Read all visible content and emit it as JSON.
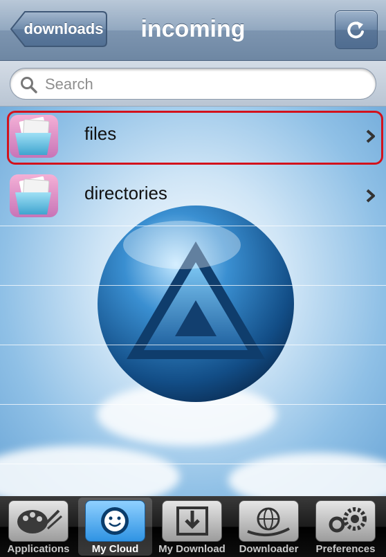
{
  "nav": {
    "back_label": "downloads",
    "title": "incoming",
    "refresh_icon": "refresh-icon"
  },
  "search": {
    "placeholder": "Search"
  },
  "list": [
    {
      "label": "files",
      "icon": "folder-files-icon"
    },
    {
      "label": "directories",
      "icon": "folder-files-icon"
    }
  ],
  "tabs": [
    {
      "label": "Applications",
      "icon": "palette-icon",
      "active": false
    },
    {
      "label": "My Cloud",
      "icon": "cloud-face-icon",
      "active": true
    },
    {
      "label": "My Download",
      "icon": "download-tray-icon",
      "active": false
    },
    {
      "label": "Downloader",
      "icon": "globe-icon",
      "active": false
    },
    {
      "label": "Preferences",
      "icon": "gears-icon",
      "active": false
    }
  ],
  "colors": {
    "highlight": "#d3121c",
    "nav": "#7d95b0",
    "active_tab": "#2f93e3"
  }
}
